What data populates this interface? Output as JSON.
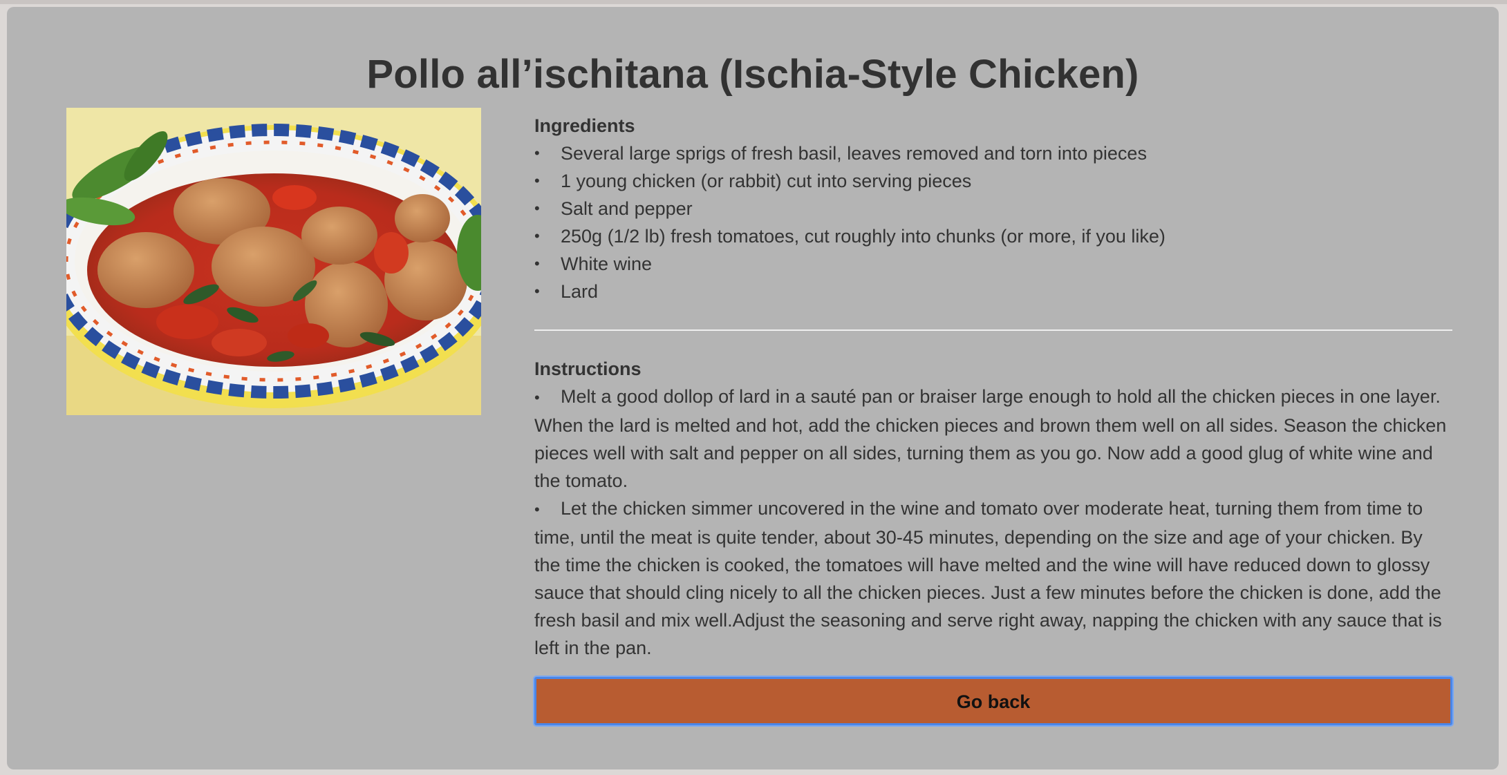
{
  "recipe": {
    "title": "Pollo all’ischitana (Ischia-Style Chicken)",
    "ingredients_heading": "Ingredients",
    "ingredients": [
      "Several large sprigs of fresh basil, leaves removed and torn into pieces",
      "1 young chicken (or rabbit) cut into serving pieces",
      "Salt and pepper",
      "250g (1/2 lb) fresh tomatoes, cut roughly into chunks (or more, if you like)",
      "White wine",
      "Lard"
    ],
    "instructions_heading": "Instructions",
    "instructions": [
      "Melt a good dollop of lard in a sauté pan or braiser large enough to hold all the chicken pieces in one layer. When the lard is melted and hot, add the chicken pieces and brown them well on all sides. Season the chicken pieces well with salt and pepper on all sides, turning them as you go. Now add a good glug of white wine and the tomato.",
      "Let the chicken simmer uncovered in the wine and tomato over moderate heat, turning them from time to time, until the meat is quite tender, about 30-45 minutes, depending on the size and age of your chicken. By the time the chicken is cooked, the tomatoes will have melted and the wine will have reduced down to glossy sauce that should cling nicely to all the chicken pieces. Just a few minutes before the chicken is done, add the fresh basil and mix well.Adjust the seasoning and serve right away, napping the chicken with any sauce that is left in the pan."
    ],
    "back_button_label": "Go back"
  },
  "colors": {
    "page_background": "#b4b4b4",
    "button_background": "#b85c31",
    "button_focus_ring": "#4a86e8",
    "text": "#333333"
  }
}
